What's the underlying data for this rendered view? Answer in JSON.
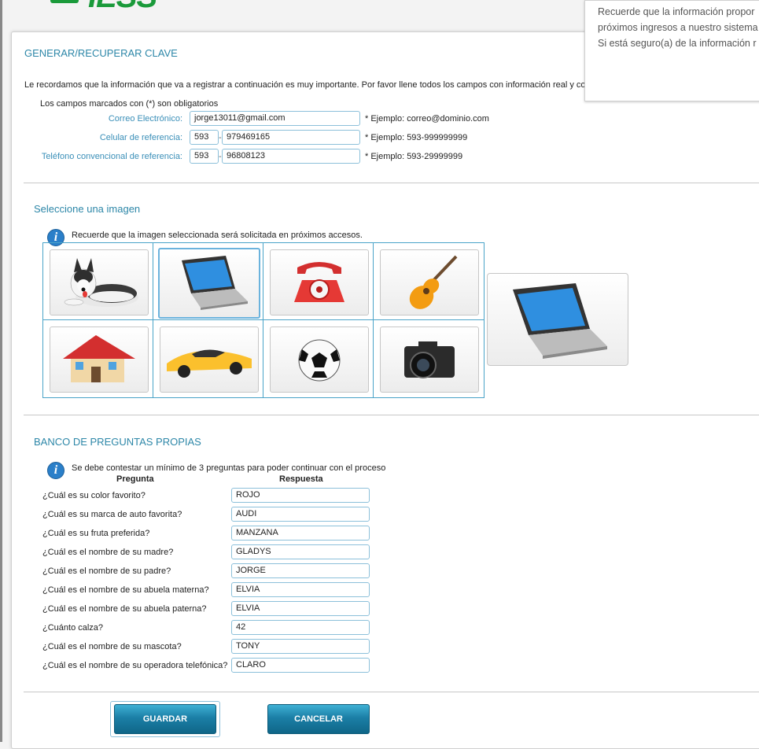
{
  "logo": {
    "text": "IESS"
  },
  "popup": {
    "lines": [
      "Recuerde que la información propor",
      "próximos ingresos a nuestro sistema",
      "Si está seguro(a) de la información r"
    ]
  },
  "header": {
    "title": "GENERAR/RECUPERAR CLAVE",
    "intro": "Le recordamos que la información que va a registrar a continuación es muy importante. Por favor llene todos los campos con información real y co",
    "required_note": "Los campos marcados con (*) son obligatorios"
  },
  "contact": {
    "email_label": "Correo Electrónico:",
    "email_value": "jorge13011@gmail.com",
    "email_hint": "* Ejemplo: correo@dominio.com",
    "cell_label": "Celular de referencia:",
    "cell_prefix": "593",
    "cell_value": "979469165",
    "cell_hint": "* Ejemplo: 593-999999999",
    "phone_label": "Teléfono convencional de referencia:",
    "phone_prefix": "593",
    "phone_value": "96808123",
    "phone_hint": "* Ejemplo: 593-29999999",
    "dash": "-"
  },
  "image_section": {
    "title": "Seleccione una imagen",
    "note": "Recuerde que la imagen seleccionada será solicitada en próximos accesos.",
    "images": [
      "dog",
      "laptop",
      "telephone",
      "guitar",
      "house",
      "car",
      "soccer-ball",
      "camera"
    ],
    "selected": "laptop"
  },
  "questions_section": {
    "title": "BANCO DE PREGUNTAS PROPIAS",
    "note": "Se debe contestar un mínimo de 3 preguntas para poder continuar con el proceso",
    "col_question": "Pregunta",
    "col_answer": "Respuesta",
    "rows": [
      {
        "q": "¿Cuál es su color favorito?",
        "a": "ROJO"
      },
      {
        "q": "¿Cuál es su marca de auto favorita?",
        "a": "AUDI"
      },
      {
        "q": "¿Cuál es su fruta preferida?",
        "a": "MANZANA"
      },
      {
        "q": "¿Cuál es el nombre de su madre?",
        "a": "GLADYS"
      },
      {
        "q": "¿Cuál es el nombre de su padre?",
        "a": "JORGE"
      },
      {
        "q": "¿Cuál es el nombre de su abuela materna?",
        "a": "ELVIA"
      },
      {
        "q": "¿Cuál es el nombre de su abuela paterna?",
        "a": "ELVIA"
      },
      {
        "q": "¿Cuánto calza?",
        "a": "42"
      },
      {
        "q": "¿Cuál es el nombre de su mascota?",
        "a": "TONY"
      },
      {
        "q": "¿Cuál es el nombre de su operadora telefónica?",
        "a": "CLARO"
      }
    ]
  },
  "buttons": {
    "save": "GUARDAR",
    "cancel": "CANCELAR"
  },
  "info_glyph": "i",
  "colors": {
    "accent": "#2d87a8",
    "label": "#3a8fb8",
    "button": "#1b7fa6",
    "grid_border": "#4aa3c8"
  }
}
